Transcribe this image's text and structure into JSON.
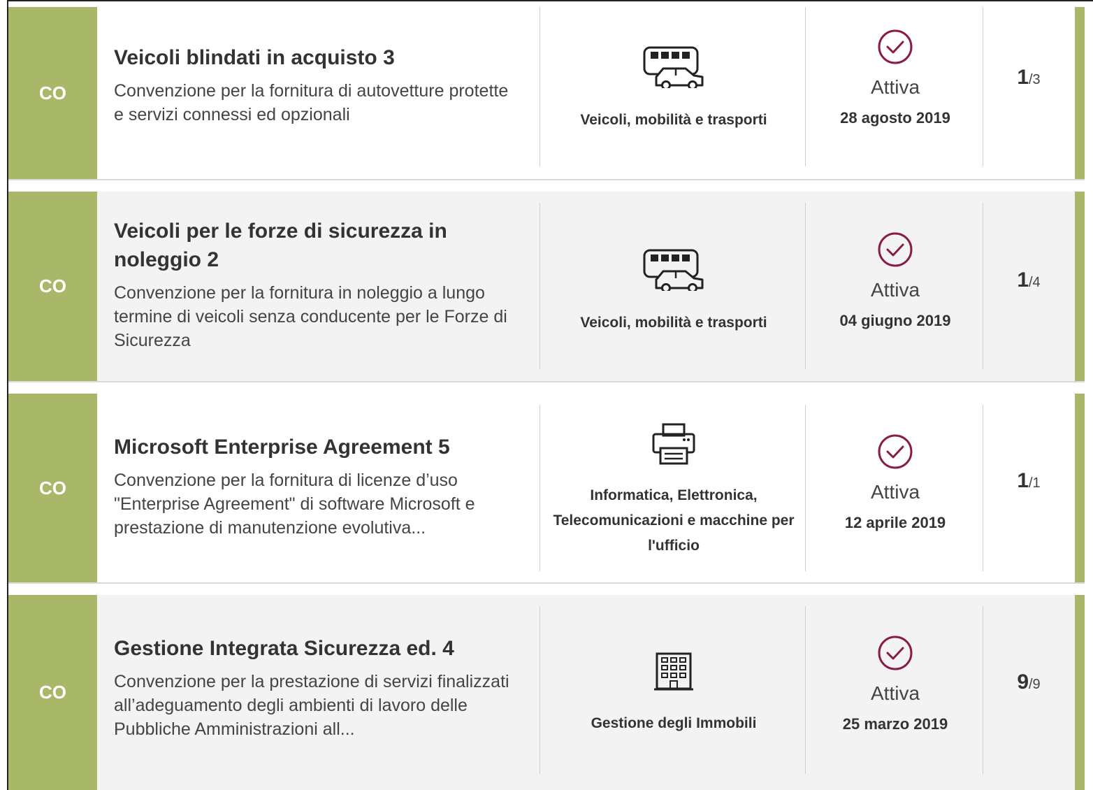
{
  "colors": {
    "badge_green": "#a8b868",
    "status_purple": "#8a1a4a"
  },
  "items": [
    {
      "badge": "CO",
      "title": "Veicoli blindati in acquisto 3",
      "description": "Convenzione per la fornitura di autovetture protette e servizi connessi ed opzionali",
      "category_icon": "bus-car-icon",
      "category": "Veicoli, mobilità e trasporti",
      "status_icon": "check-circle-icon",
      "status": "Attiva",
      "date": "28 agosto 2019",
      "count_num": "1",
      "count_den": "/3"
    },
    {
      "badge": "CO",
      "title": "Veicoli per le forze di sicurezza in noleggio 2",
      "description": "Convenzione per la fornitura in noleggio a lungo termine di veicoli senza conducente per le Forze di Sicurezza",
      "category_icon": "bus-car-icon",
      "category": "Veicoli, mobilità e trasporti",
      "status_icon": "check-circle-icon",
      "status": "Attiva",
      "date": "04 giugno 2019",
      "count_num": "1",
      "count_den": "/4"
    },
    {
      "badge": "CO",
      "title": "Microsoft Enterprise Agreement 5",
      "description": "Convenzione per la fornitura di licenze d’uso \"Enterprise Agreement\" di software Microsoft e prestazione di manutenzione evolutiva...",
      "category_icon": "printer-icon",
      "category": "Informatica, Elettronica, Telecomunicazioni e macchine per l'ufficio",
      "status_icon": "check-circle-icon",
      "status": "Attiva",
      "date": "12 aprile 2019",
      "count_num": "1",
      "count_den": "/1"
    },
    {
      "badge": "CO",
      "title": "Gestione Integrata Sicurezza ed. 4",
      "description": "Convenzione per la prestazione di servizi finalizzati all’adeguamento degli ambienti di lavoro delle Pubbliche Amministrazioni all...",
      "category_icon": "building-icon",
      "category": "Gestione degli Immobili",
      "status_icon": "check-circle-icon",
      "status": "Attiva",
      "date": "25 marzo 2019",
      "count_num": "9",
      "count_den": "/9"
    }
  ]
}
